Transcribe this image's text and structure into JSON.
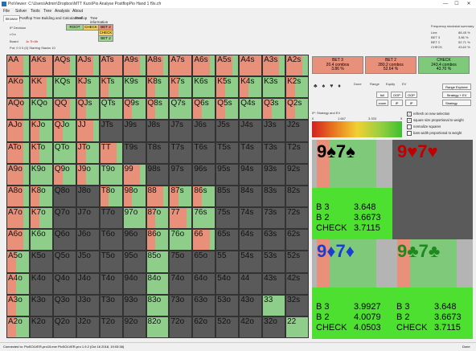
{
  "window": {
    "title": "PioViewer: C:\\Users\\Admin\\Dropbox\\MTT Kurs\\Pio Analyse PostflopPio Hand 1 f9s.cfr",
    "min": "—",
    "max": "☐",
    "close": "✕"
  },
  "menu": [
    "File",
    "Solver",
    "Tools",
    "Tree",
    "Analysis",
    "About"
  ],
  "tabs": [
    "Browse",
    "Postflop Tree Building and Calculations",
    "Preflop",
    "Tree information"
  ],
  "actions": {
    "root": "ROOT",
    "check": "CHECK",
    "bet": "BET 2",
    "check2": "CHECK",
    "bet2": "BET 2"
  },
  "info": {
    "ip_decision": "IP Decision",
    "path": "r:0:c",
    "board_label": "Board",
    "board": "Jc 7h 6h",
    "pot": "Pot: 0 0 0 (0) Starting Stacks 10"
  },
  "freq": {
    "header": "Frequency stockstat summary",
    "rows": [
      {
        "label": "Line",
        "value": "88.45 %"
      },
      {
        "label": "BET 3",
        "value": "3.86 %"
      },
      {
        "label": "BET 2",
        "value": "52.71 %"
      },
      {
        "label": "CHECK",
        "value": "43.62 %"
      }
    ]
  },
  "strategy": [
    {
      "name": "BET 3",
      "combos": "20.4 combos",
      "pct": "3.86 %",
      "color": "#e9907a"
    },
    {
      "name": "BET 2",
      "combos": "280.2 combos",
      "pct": "52.64 %",
      "color": "#e9907a"
    },
    {
      "name": "CHECK",
      "combos": "243.4 combos",
      "pct": "43.70 %",
      "color": "#7fc97a"
    }
  ],
  "controls": {
    "suits": "♣ ♠ ♥ ♦",
    "cols": [
      "Done",
      "Range",
      "Equity",
      "EV"
    ],
    "btn_full": "full",
    "btn_ooop": "OOP",
    "btn_oop2": "OOP",
    "btn_zoom": "zoom",
    "btn_ip": "IP",
    "btn_ip2": "IP",
    "range_explorer": "Range Explorer",
    "strategy_ev": "Strategy + EV",
    "strategy": "Strategy",
    "mode_label": "IP: Strategy and EV",
    "scale": [
      "0",
      "1.667",
      "3.333",
      "5"
    ],
    "checks": [
      {
        "label": "refresh on new selection",
        "on": true
      },
      {
        "label": "square size proportional to weight",
        "on": true
      },
      {
        "label": "normalize squares",
        "on": false
      },
      {
        "label": "bars width proportional to weight",
        "on": false
      }
    ]
  },
  "cards": [
    {
      "title": "9♠7♠",
      "suit_color": "#000",
      "dimmed": false,
      "rows": [
        {
          "k": "B 3",
          "v": "3.648"
        },
        {
          "k": "B 2",
          "v": "3.6673"
        },
        {
          "k": "CHECK",
          "v": "3.7115"
        }
      ]
    },
    {
      "title": "9♥7♥",
      "suit_color": "#c00000",
      "dimmed": true,
      "rows": []
    },
    {
      "title": "9♦7♦",
      "suit_color": "#1a3fd0",
      "dimmed": false,
      "rows": [
        {
          "k": "B 3",
          "v": "3.9927"
        },
        {
          "k": "B 2",
          "v": "4.0079"
        },
        {
          "k": "CHECK",
          "v": "4.0503"
        }
      ]
    },
    {
      "title": "9♣7♣",
      "suit_color": "#1d8a1d",
      "dimmed": false,
      "rows": [
        {
          "k": "B 3",
          "v": "3.648"
        },
        {
          "k": "B 2",
          "v": "3.6673"
        },
        {
          "k": "CHECK",
          "v": "3.7115"
        }
      ]
    }
  ],
  "matrix": {
    "ranks": [
      "A",
      "K",
      "Q",
      "J",
      "T",
      "9",
      "8",
      "7",
      "6",
      "5",
      "4",
      "3",
      "2"
    ],
    "sub": "EI  ##\n#  #",
    "colors": {
      "bet": "#e9907a",
      "check": "#8fce8a",
      "empty": "#5a5a5a",
      "grey": "#9a9a9a"
    }
  },
  "status": {
    "left": "Connected to: PioSOLVER-pro15.exe PioSOLVER-pro 1.9.2 (Oct 16 2018, 19:03:38)",
    "right": "Done"
  }
}
